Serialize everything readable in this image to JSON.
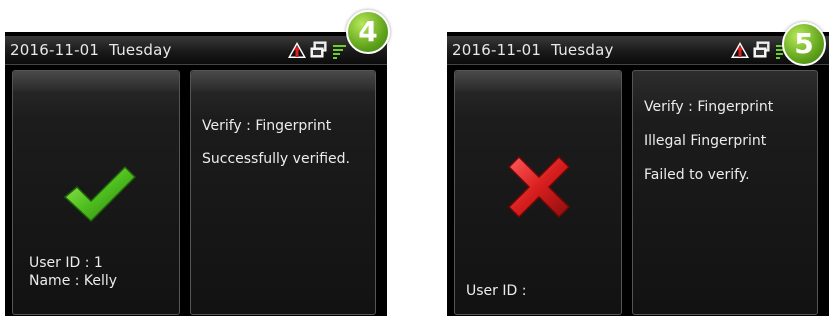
{
  "left": {
    "date": "2016-11-01  Tuesday",
    "badge": "4",
    "verify_text": "Verify : Fingerprint",
    "result_text": "Successfully verified.",
    "user_id": "User ID : 1",
    "name": "Name : Kelly",
    "result_icon": "check-icon"
  },
  "right": {
    "date": "2016-11-01  Tuesday",
    "badge": "5",
    "verify_text": "Verify : Fingerprint",
    "illegal_text": "Illegal Fingerprint",
    "result_text": "Failed to verify.",
    "user_id": "User ID :",
    "result_icon": "cross-icon"
  },
  "status_icons": [
    "alarm-warning-icon",
    "network-computer-icon",
    "wifi-signal-icon"
  ],
  "colors": {
    "success": "#4fbf1f",
    "failure": "#d81e1e",
    "badge": "#62a51c",
    "background": "#000000"
  }
}
